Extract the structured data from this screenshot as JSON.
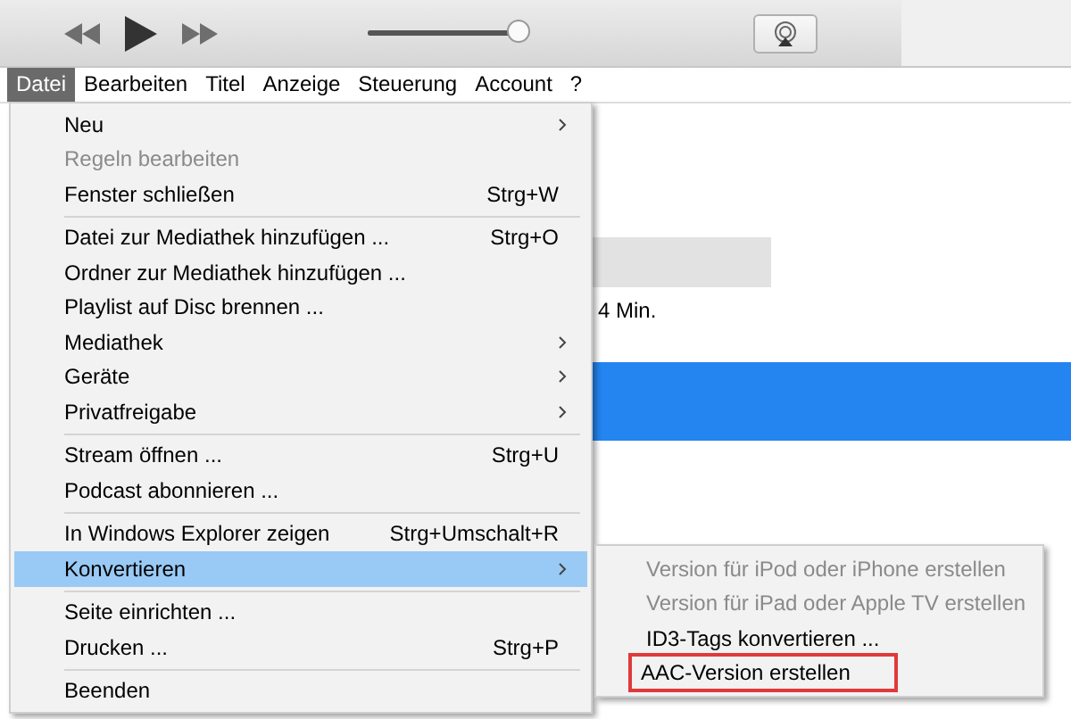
{
  "player": {
    "volume": {
      "level": 0.95
    }
  },
  "menubar": [
    {
      "label": "Datei",
      "selected": true
    },
    {
      "label": "Bearbeiten",
      "selected": false
    },
    {
      "label": "Titel",
      "selected": false
    },
    {
      "label": "Anzeige",
      "selected": false
    },
    {
      "label": "Steuerung",
      "selected": false
    },
    {
      "label": "Account",
      "selected": false
    },
    {
      "label": "?",
      "selected": false
    }
  ],
  "library": {
    "duration": "4 Min."
  },
  "file_menu": [
    {
      "kind": "item",
      "label": "Neu",
      "disabled": false,
      "selected": false,
      "submenu": true
    },
    {
      "kind": "item",
      "label": "Regeln bearbeiten",
      "disabled": true,
      "selected": false,
      "submenu": false
    },
    {
      "kind": "item",
      "label": "Fenster schließen",
      "shortcut": "Strg+W",
      "disabled": false,
      "selected": false,
      "submenu": false
    },
    {
      "kind": "separator"
    },
    {
      "kind": "item",
      "label": "Datei zur Mediathek hinzufügen ...",
      "shortcut": "Strg+O",
      "disabled": false,
      "selected": false,
      "submenu": false
    },
    {
      "kind": "item",
      "label": "Ordner zur Mediathek hinzufügen ...",
      "disabled": false,
      "selected": false,
      "submenu": false
    },
    {
      "kind": "item",
      "label": "Playlist auf Disc brennen ...",
      "disabled": false,
      "selected": false,
      "submenu": false
    },
    {
      "kind": "item",
      "label": "Mediathek",
      "disabled": false,
      "selected": false,
      "submenu": true
    },
    {
      "kind": "item",
      "label": "Geräte",
      "disabled": false,
      "selected": false,
      "submenu": true
    },
    {
      "kind": "item",
      "label": "Privatfreigabe",
      "disabled": false,
      "selected": false,
      "submenu": true
    },
    {
      "kind": "separator"
    },
    {
      "kind": "item",
      "label": "Stream öffnen ...",
      "shortcut": "Strg+U",
      "disabled": false,
      "selected": false,
      "submenu": false
    },
    {
      "kind": "item",
      "label": "Podcast abonnieren ...",
      "disabled": false,
      "selected": false,
      "submenu": false
    },
    {
      "kind": "separator"
    },
    {
      "kind": "item",
      "label": "In Windows Explorer zeigen",
      "shortcut": "Strg+Umschalt+R",
      "disabled": false,
      "selected": false,
      "submenu": false
    },
    {
      "kind": "item",
      "label": "Konvertieren",
      "disabled": false,
      "selected": true,
      "submenu": true
    },
    {
      "kind": "separator"
    },
    {
      "kind": "item",
      "label": "Seite einrichten ...",
      "disabled": false,
      "selected": false,
      "submenu": false
    },
    {
      "kind": "item",
      "label": "Drucken ...",
      "shortcut": "Strg+P",
      "disabled": false,
      "selected": false,
      "submenu": false
    },
    {
      "kind": "separator"
    },
    {
      "kind": "item",
      "label": "Beenden",
      "disabled": false,
      "selected": false,
      "submenu": false
    }
  ],
  "convert_submenu": [
    {
      "label": "Version für iPod oder iPhone erstellen",
      "disabled": true,
      "boxed": false
    },
    {
      "label": "Version für iPad oder Apple TV erstellen",
      "disabled": true,
      "boxed": false
    },
    {
      "label": "ID3-Tags konvertieren ...",
      "disabled": false,
      "boxed": false
    },
    {
      "label": "AAC-Version erstellen",
      "disabled": false,
      "boxed": true
    }
  ]
}
